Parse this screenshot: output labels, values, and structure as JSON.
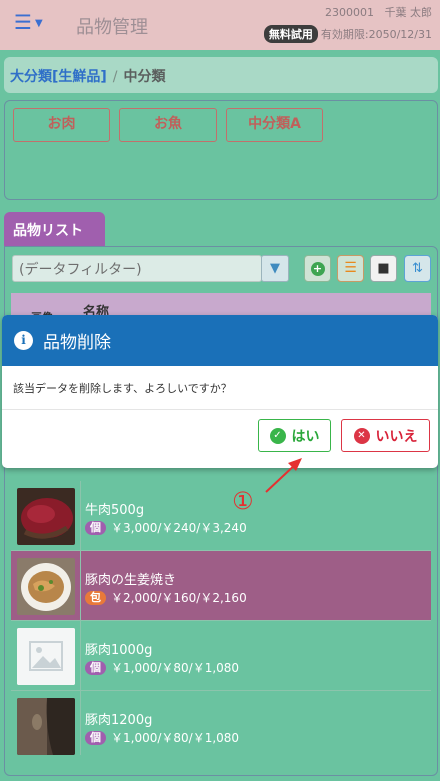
{
  "header": {
    "menu_icon": "hamburger-icon",
    "title": "品物管理",
    "user_id": "2300001",
    "user_name": "千葉 太郎",
    "trial_badge": "無料試用",
    "expiry": "有効期限:2050/12/31"
  },
  "breadcrumb": {
    "parent": "大分類[生鮮品]",
    "separator": "/",
    "current": "中分類"
  },
  "categories": [
    "お肉",
    "お魚",
    "中分類A"
  ],
  "list": {
    "tab_label": "品物リスト",
    "filter_placeholder": "(データフィルター)",
    "col_name": "名称",
    "col_image": "画像",
    "rows": [
      {
        "name": "牛肉500g",
        "badge": "個",
        "price": "￥3,000/￥240/￥3,240",
        "selected": false
      },
      {
        "name": "豚肉の生姜焼き",
        "badge": "包",
        "price": "￥2,000/￥160/￥2,160",
        "selected": true
      },
      {
        "name": "豚肉1000g",
        "badge": "個",
        "price": "￥1,000/￥80/￥1,080",
        "selected": false
      },
      {
        "name": "豚肉1200g",
        "badge": "個",
        "price": "￥1,000/￥80/￥1,080",
        "selected": false
      }
    ]
  },
  "modal": {
    "title": "品物削除",
    "message": "該当データを削除します、よろしいですか？",
    "yes_label": "はい",
    "no_label": "いいえ"
  },
  "annotation": {
    "number": "①"
  },
  "colors": {
    "background": "#6ac3a0",
    "header": "#e6c3c4",
    "modal_header": "#1a70b8",
    "selected_row": "#9e5e87",
    "tab": "#a05fae"
  }
}
